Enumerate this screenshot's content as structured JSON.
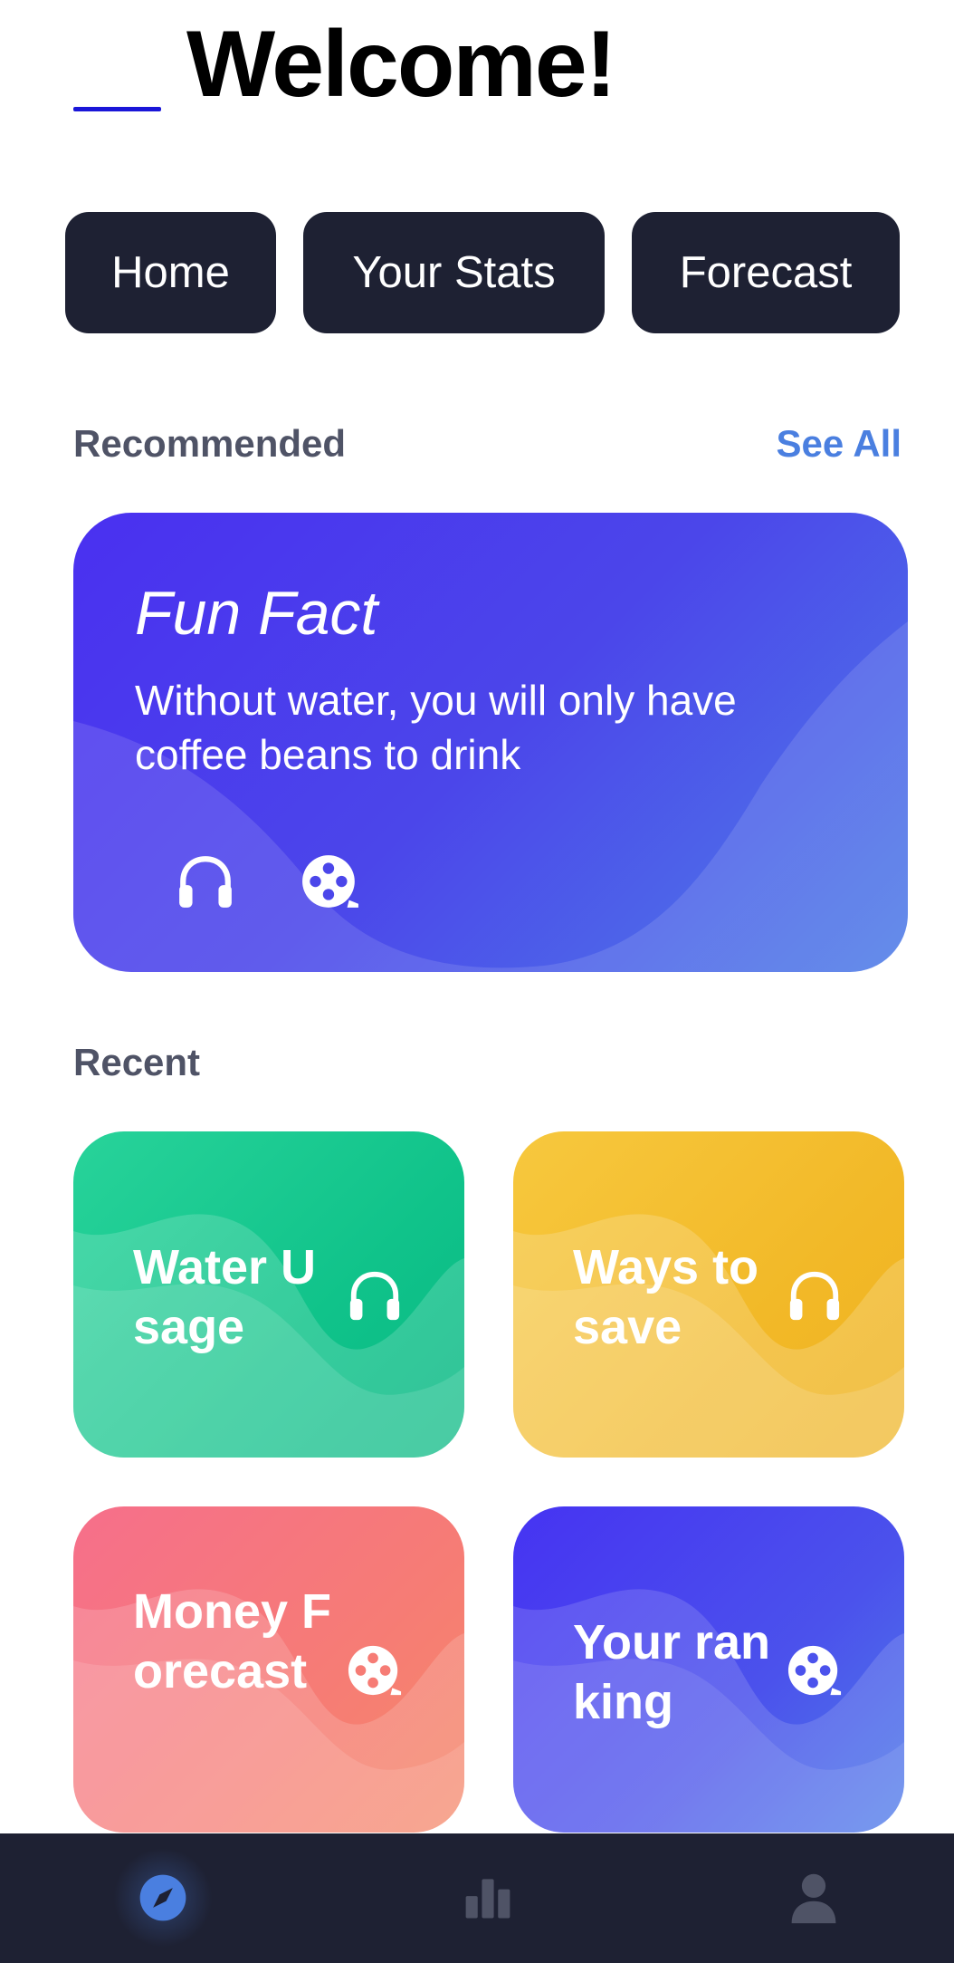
{
  "header": {
    "title": "Welcome!"
  },
  "nav": {
    "home": "Home",
    "stats": "Your Stats",
    "forecast": "Forecast"
  },
  "recommended": {
    "label": "Recommended",
    "see_all": "See All",
    "card": {
      "title": "Fun Fact",
      "body": "Without water, you will only have coffee beans to drink"
    }
  },
  "recent": {
    "label": "Recent",
    "cards": [
      {
        "title": "Water Usage",
        "icon": "headphones-icon",
        "color": "#10c38a"
      },
      {
        "title": "Ways to save",
        "icon": "headphones-icon",
        "color": "#f2b928"
      },
      {
        "title": "Money Forecast",
        "icon": "film-reel-icon",
        "color": "#f67c75"
      },
      {
        "title": "Your ranking",
        "icon": "film-reel-icon",
        "color": "#4b52ec"
      }
    ]
  },
  "bottom_nav": {
    "items": [
      {
        "icon": "compass-icon",
        "active": true
      },
      {
        "icon": "bar-chart-icon",
        "active": false
      },
      {
        "icon": "user-icon",
        "active": false
      }
    ]
  },
  "colors": {
    "dark": "#1e2133",
    "accent": "#4a7fe0",
    "menu_line": "#1a16d8",
    "section_label": "#4f5366"
  }
}
